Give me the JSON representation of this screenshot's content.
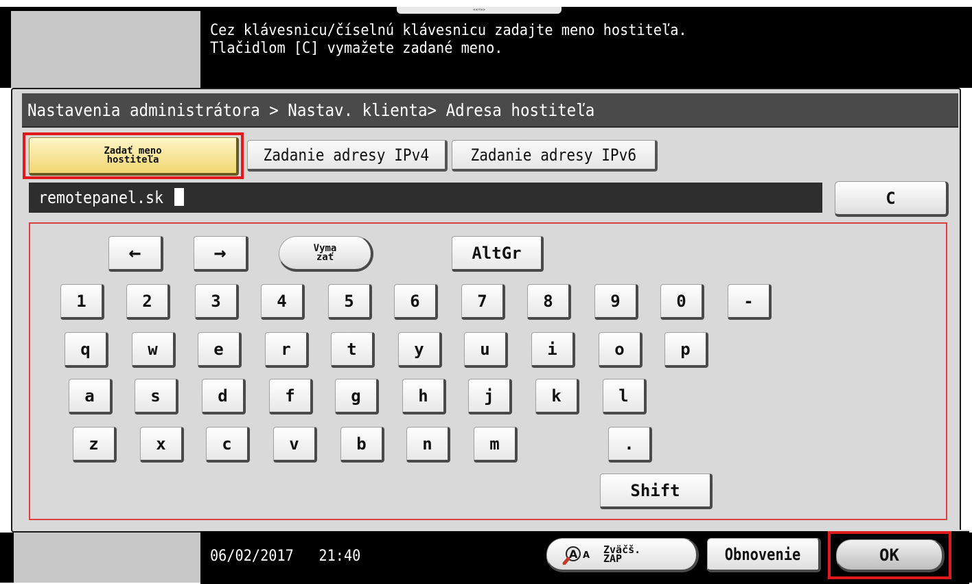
{
  "top": {
    "handle_label": "<<+>>",
    "message": "Cez klávesnicu/číselnú klávesnicu zadajte meno hostiteľa.\nTlačidlom [C] vymažete zadané meno."
  },
  "breadcrumb": "Nastavenia administrátora > Nastav. klienta> Adresa hostiteľa",
  "tabs": {
    "hostname": "Zadať meno\nhostiteľa",
    "ipv4": "Zadanie adresy IPv4",
    "ipv6": "Zadanie adresy IPv6"
  },
  "input": {
    "value": "remotepanel.sk"
  },
  "clear_label": "C",
  "keyboard": {
    "left_arrow": "←",
    "right_arrow": "→",
    "delete_label": "Vyma\nzať",
    "altgr": "AltGr",
    "row_numbers": [
      "1",
      "2",
      "3",
      "4",
      "5",
      "6",
      "7",
      "8",
      "9",
      "0",
      "-"
    ],
    "row_q": [
      "q",
      "w",
      "e",
      "r",
      "t",
      "y",
      "u",
      "i",
      "o",
      "p"
    ],
    "row_a": [
      "a",
      "s",
      "d",
      "f",
      "g",
      "h",
      "j",
      "k",
      "l"
    ],
    "row_z": [
      "z",
      "x",
      "c",
      "v",
      "b",
      "n",
      "m"
    ],
    "dot": ".",
    "shift": "Shift"
  },
  "status": {
    "date": "06/02/2017",
    "time": "21:40",
    "zoom_label": "Zväčš.\nZAP",
    "refresh_label": "Obnovenie",
    "ok_label": "OK"
  },
  "colors": {
    "highlight_outline": "#e01a1a",
    "selected_tab": "#f0d670",
    "background_dark": "#000000"
  }
}
